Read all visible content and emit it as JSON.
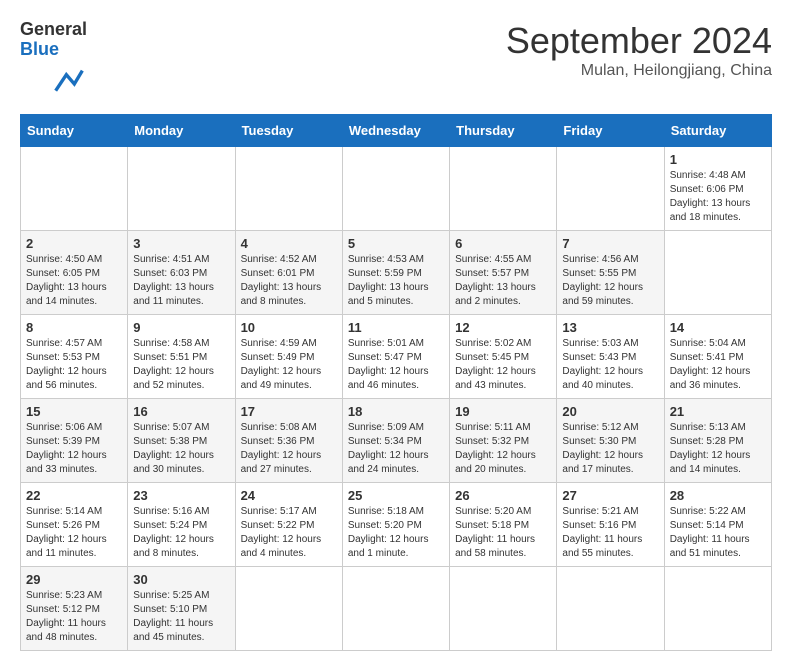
{
  "header": {
    "logo_general": "General",
    "logo_blue": "Blue",
    "month_title": "September 2024",
    "location": "Mulan, Heilongjiang, China"
  },
  "calendar": {
    "days": [
      "Sunday",
      "Monday",
      "Tuesday",
      "Wednesday",
      "Thursday",
      "Friday",
      "Saturday"
    ],
    "weeks": [
      [
        null,
        null,
        null,
        null,
        null,
        null,
        {
          "day": "1",
          "sunrise": "Sunrise: 4:48 AM",
          "sunset": "Sunset: 6:06 PM",
          "daylight": "Daylight: 13 hours and 18 minutes."
        }
      ],
      [
        {
          "day": "2",
          "sunrise": "Sunrise: 4:50 AM",
          "sunset": "Sunset: 6:05 PM",
          "daylight": "Daylight: 13 hours and 14 minutes."
        },
        {
          "day": "3",
          "sunrise": "Sunrise: 4:51 AM",
          "sunset": "Sunset: 6:03 PM",
          "daylight": "Daylight: 13 hours and 11 minutes."
        },
        {
          "day": "4",
          "sunrise": "Sunrise: 4:52 AM",
          "sunset": "Sunset: 6:01 PM",
          "daylight": "Daylight: 13 hours and 8 minutes."
        },
        {
          "day": "5",
          "sunrise": "Sunrise: 4:53 AM",
          "sunset": "Sunset: 5:59 PM",
          "daylight": "Daylight: 13 hours and 5 minutes."
        },
        {
          "day": "6",
          "sunrise": "Sunrise: 4:55 AM",
          "sunset": "Sunset: 5:57 PM",
          "daylight": "Daylight: 13 hours and 2 minutes."
        },
        {
          "day": "7",
          "sunrise": "Sunrise: 4:56 AM",
          "sunset": "Sunset: 5:55 PM",
          "daylight": "Daylight: 12 hours and 59 minutes."
        }
      ],
      [
        {
          "day": "8",
          "sunrise": "Sunrise: 4:57 AM",
          "sunset": "Sunset: 5:53 PM",
          "daylight": "Daylight: 12 hours and 56 minutes."
        },
        {
          "day": "9",
          "sunrise": "Sunrise: 4:58 AM",
          "sunset": "Sunset: 5:51 PM",
          "daylight": "Daylight: 12 hours and 52 minutes."
        },
        {
          "day": "10",
          "sunrise": "Sunrise: 4:59 AM",
          "sunset": "Sunset: 5:49 PM",
          "daylight": "Daylight: 12 hours and 49 minutes."
        },
        {
          "day": "11",
          "sunrise": "Sunrise: 5:01 AM",
          "sunset": "Sunset: 5:47 PM",
          "daylight": "Daylight: 12 hours and 46 minutes."
        },
        {
          "day": "12",
          "sunrise": "Sunrise: 5:02 AM",
          "sunset": "Sunset: 5:45 PM",
          "daylight": "Daylight: 12 hours and 43 minutes."
        },
        {
          "day": "13",
          "sunrise": "Sunrise: 5:03 AM",
          "sunset": "Sunset: 5:43 PM",
          "daylight": "Daylight: 12 hours and 40 minutes."
        },
        {
          "day": "14",
          "sunrise": "Sunrise: 5:04 AM",
          "sunset": "Sunset: 5:41 PM",
          "daylight": "Daylight: 12 hours and 36 minutes."
        }
      ],
      [
        {
          "day": "15",
          "sunrise": "Sunrise: 5:06 AM",
          "sunset": "Sunset: 5:39 PM",
          "daylight": "Daylight: 12 hours and 33 minutes."
        },
        {
          "day": "16",
          "sunrise": "Sunrise: 5:07 AM",
          "sunset": "Sunset: 5:38 PM",
          "daylight": "Daylight: 12 hours and 30 minutes."
        },
        {
          "day": "17",
          "sunrise": "Sunrise: 5:08 AM",
          "sunset": "Sunset: 5:36 PM",
          "daylight": "Daylight: 12 hours and 27 minutes."
        },
        {
          "day": "18",
          "sunrise": "Sunrise: 5:09 AM",
          "sunset": "Sunset: 5:34 PM",
          "daylight": "Daylight: 12 hours and 24 minutes."
        },
        {
          "day": "19",
          "sunrise": "Sunrise: 5:11 AM",
          "sunset": "Sunset: 5:32 PM",
          "daylight": "Daylight: 12 hours and 20 minutes."
        },
        {
          "day": "20",
          "sunrise": "Sunrise: 5:12 AM",
          "sunset": "Sunset: 5:30 PM",
          "daylight": "Daylight: 12 hours and 17 minutes."
        },
        {
          "day": "21",
          "sunrise": "Sunrise: 5:13 AM",
          "sunset": "Sunset: 5:28 PM",
          "daylight": "Daylight: 12 hours and 14 minutes."
        }
      ],
      [
        {
          "day": "22",
          "sunrise": "Sunrise: 5:14 AM",
          "sunset": "Sunset: 5:26 PM",
          "daylight": "Daylight: 12 hours and 11 minutes."
        },
        {
          "day": "23",
          "sunrise": "Sunrise: 5:16 AM",
          "sunset": "Sunset: 5:24 PM",
          "daylight": "Daylight: 12 hours and 8 minutes."
        },
        {
          "day": "24",
          "sunrise": "Sunrise: 5:17 AM",
          "sunset": "Sunset: 5:22 PM",
          "daylight": "Daylight: 12 hours and 4 minutes."
        },
        {
          "day": "25",
          "sunrise": "Sunrise: 5:18 AM",
          "sunset": "Sunset: 5:20 PM",
          "daylight": "Daylight: 12 hours and 1 minute."
        },
        {
          "day": "26",
          "sunrise": "Sunrise: 5:20 AM",
          "sunset": "Sunset: 5:18 PM",
          "daylight": "Daylight: 11 hours and 58 minutes."
        },
        {
          "day": "27",
          "sunrise": "Sunrise: 5:21 AM",
          "sunset": "Sunset: 5:16 PM",
          "daylight": "Daylight: 11 hours and 55 minutes."
        },
        {
          "day": "28",
          "sunrise": "Sunrise: 5:22 AM",
          "sunset": "Sunset: 5:14 PM",
          "daylight": "Daylight: 11 hours and 51 minutes."
        }
      ],
      [
        {
          "day": "29",
          "sunrise": "Sunrise: 5:23 AM",
          "sunset": "Sunset: 5:12 PM",
          "daylight": "Daylight: 11 hours and 48 minutes."
        },
        {
          "day": "30",
          "sunrise": "Sunrise: 5:25 AM",
          "sunset": "Sunset: 5:10 PM",
          "daylight": "Daylight: 11 hours and 45 minutes."
        },
        null,
        null,
        null,
        null,
        null
      ]
    ]
  }
}
